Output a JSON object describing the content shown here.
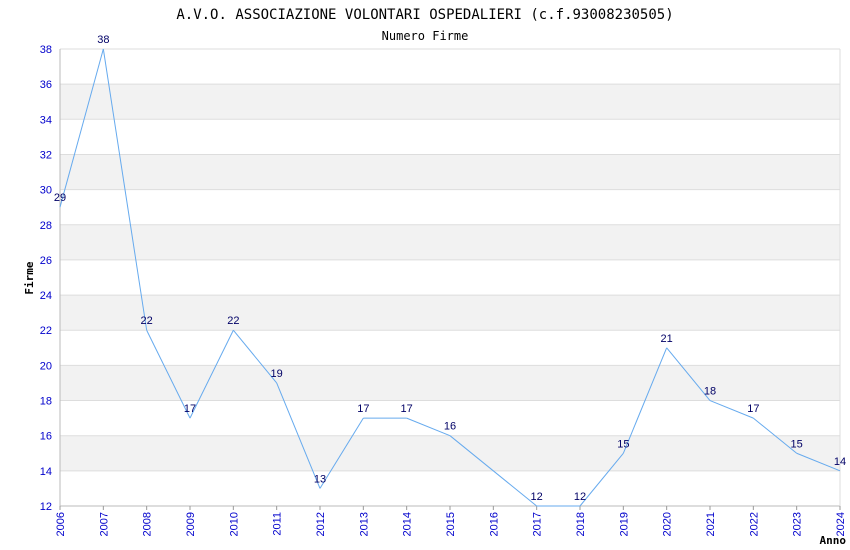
{
  "chart_data": {
    "type": "line",
    "title": "A.V.O. ASSOCIAZIONE VOLONTARI OSPEDALIERI (c.f.93008230505)",
    "subtitle": "Numero Firme",
    "xlabel": "Anno",
    "ylabel": "Firme",
    "x": [
      "2006",
      "2007",
      "2008",
      "2009",
      "2010",
      "2011",
      "2012",
      "2013",
      "2014",
      "2015",
      "2016",
      "2017",
      "2018",
      "2019",
      "2020",
      "2021",
      "2022",
      "2023",
      "2024"
    ],
    "values": [
      29,
      38,
      22,
      17,
      22,
      19,
      13,
      17,
      17,
      16,
      null,
      12,
      12,
      15,
      21,
      18,
      17,
      15,
      14
    ],
    "labels": [
      "29",
      "38",
      "22",
      "17",
      "22",
      "19",
      "13",
      "17",
      "17",
      "16",
      "",
      "12",
      "12",
      "15",
      "21",
      "18",
      "17",
      "15",
      "14"
    ],
    "ylim": [
      12,
      38
    ],
    "yticks": [
      12,
      14,
      16,
      18,
      20,
      22,
      24,
      26,
      28,
      30,
      32,
      34,
      36,
      38
    ],
    "grid": true,
    "colors": {
      "line": "#66aaee",
      "band": "#f2f2f2",
      "grid": "#dddddd",
      "tick": "#0000cc",
      "label": "#000066"
    }
  }
}
